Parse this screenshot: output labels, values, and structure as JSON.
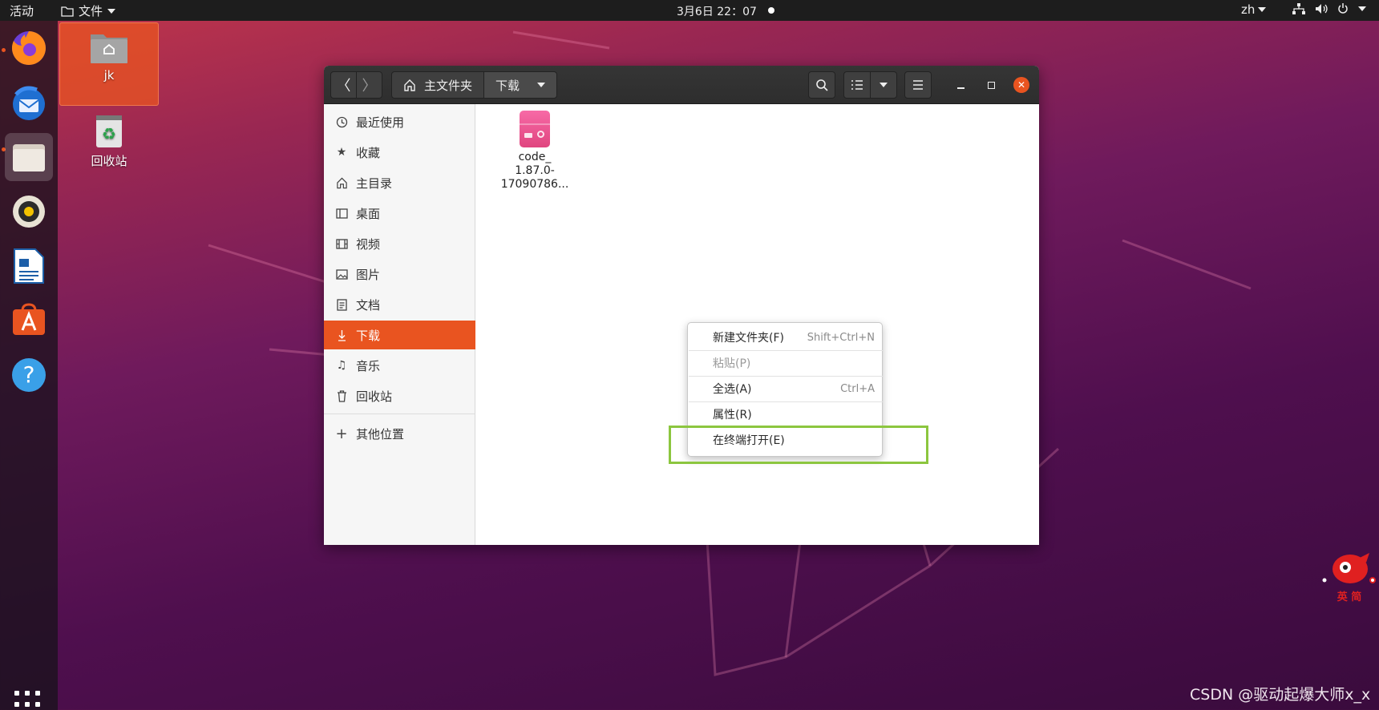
{
  "topbar": {
    "activities": "活动",
    "app_menu": "文件",
    "clock": "3月6日  22：07",
    "lang": "zh"
  },
  "desktop": {
    "home_label": "jk",
    "trash_label": "回收站"
  },
  "window": {
    "path": [
      "主文件夹",
      "下载"
    ],
    "sidebar": [
      {
        "label": "最近使用",
        "icon": "clock-icon"
      },
      {
        "label": "收藏",
        "icon": "star-icon"
      },
      {
        "label": "主目录",
        "icon": "home-icon"
      },
      {
        "label": "桌面",
        "icon": "desktop-icon"
      },
      {
        "label": "视频",
        "icon": "film-icon"
      },
      {
        "label": "图片",
        "icon": "image-icon"
      },
      {
        "label": "文档",
        "icon": "document-icon"
      },
      {
        "label": "下载",
        "icon": "download-icon",
        "active": true
      },
      {
        "label": "音乐",
        "icon": "music-icon"
      },
      {
        "label": "回收站",
        "icon": "trash-icon"
      }
    ],
    "other_places": "其他位置",
    "files": [
      {
        "name_lines": [
          "code_",
          "1.87.0-",
          "17090786..."
        ],
        "icon": "deb-package-icon"
      }
    ]
  },
  "context_menu": {
    "items": [
      {
        "label": "新建文件夹(F)",
        "shortcut": "Shift+Ctrl+N",
        "enabled": true
      },
      {
        "label": "粘贴(P)",
        "shortcut": "",
        "enabled": false
      },
      {
        "label": "全选(A)",
        "shortcut": "Ctrl+A",
        "enabled": true
      },
      {
        "label": "属性(R)",
        "shortcut": "",
        "enabled": true
      },
      {
        "label": "在终端打开(E)",
        "shortcut": "",
        "enabled": true
      }
    ]
  },
  "watermark": "CSDN @驱动起爆大师x_x",
  "mascot_text": "英 简",
  "colors": {
    "accent": "#e95420",
    "highlight_box": "#8cc63f"
  }
}
